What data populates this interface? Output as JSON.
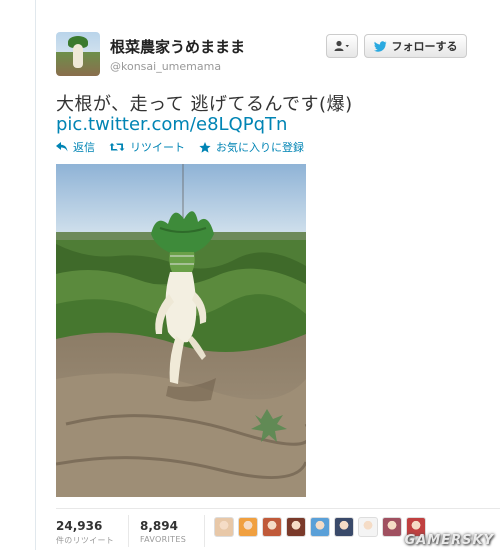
{
  "user": {
    "display_name": "根菜農家うめままま",
    "screen_name": "@konsai_umemama"
  },
  "buttons": {
    "user_menu_icon": "person-icon",
    "follow_label": "フォローする"
  },
  "tweet": {
    "text": "大根が、走って 逃げてるんです(爆)",
    "link": "pic.twitter.com/e8LQPqTn"
  },
  "actions": {
    "reply_label": "返信",
    "retweet_label": "リツイート",
    "favorite_label": "お気に入りに登録"
  },
  "stats": {
    "retweets_count": "24,936",
    "retweets_label": "件のリツイート",
    "favorites_count": "8,894",
    "favorites_label": "FAVORITES"
  },
  "faces": [
    {
      "color": "#e8c8a8",
      "icon": "avatar-1"
    },
    {
      "color": "#f0a040",
      "icon": "avatar-2"
    },
    {
      "color": "#c05a3a",
      "icon": "avatar-3"
    },
    {
      "color": "#7a3a2a",
      "icon": "avatar-4"
    },
    {
      "color": "#5aa0d8",
      "icon": "avatar-5"
    },
    {
      "color": "#3a4a6a",
      "icon": "avatar-6"
    },
    {
      "color": "#f4f4f4",
      "icon": "avatar-7"
    },
    {
      "color": "#a05060",
      "icon": "avatar-8"
    },
    {
      "color": "#c04040",
      "icon": "avatar-9"
    }
  ],
  "watermark": "GAMERSKY",
  "colors": {
    "link": "#0084b4",
    "bird": "#2aa9e0"
  }
}
